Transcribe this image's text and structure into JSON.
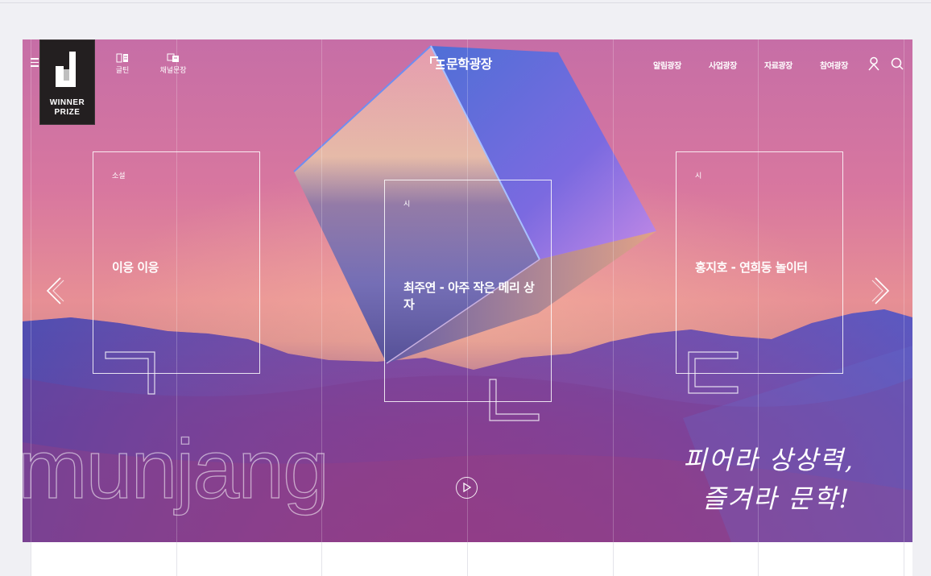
{
  "brand": {
    "name": "문학광장",
    "badge_line1": "WINNER",
    "badge_line2": "PRIZE"
  },
  "quick_links": [
    {
      "label": "글틴",
      "icon": "book-icon"
    },
    {
      "label": "채널문장",
      "icon": "channel-icon"
    }
  ],
  "main_nav": [
    {
      "label": "알림광장"
    },
    {
      "label": "사업광장"
    },
    {
      "label": "자료광장"
    },
    {
      "label": "참여광장"
    }
  ],
  "utilities": {
    "user_icon": "user-icon",
    "search_icon": "search-icon",
    "menu_icon": "hamburger-icon"
  },
  "cards": [
    {
      "category": "소설",
      "title": "이응 이응"
    },
    {
      "category": "시",
      "title": "최주연 - 아주 작은 메리 상자"
    },
    {
      "category": "시",
      "title": "홍지호 - 연희동 놀이터"
    }
  ],
  "hero": {
    "wordmark": "munjang",
    "slogan_line1": "피어라 상상력,",
    "slogan_line2": "즐겨라 문학!"
  },
  "controls": {
    "prev_icon": "chevron-left-icon",
    "next_icon": "chevron-right-icon",
    "play_icon": "play-icon"
  },
  "colors": {
    "accent_pink": "#e27aa0",
    "accent_purple": "#6a3a8e",
    "badge_bg": "#231f20"
  }
}
